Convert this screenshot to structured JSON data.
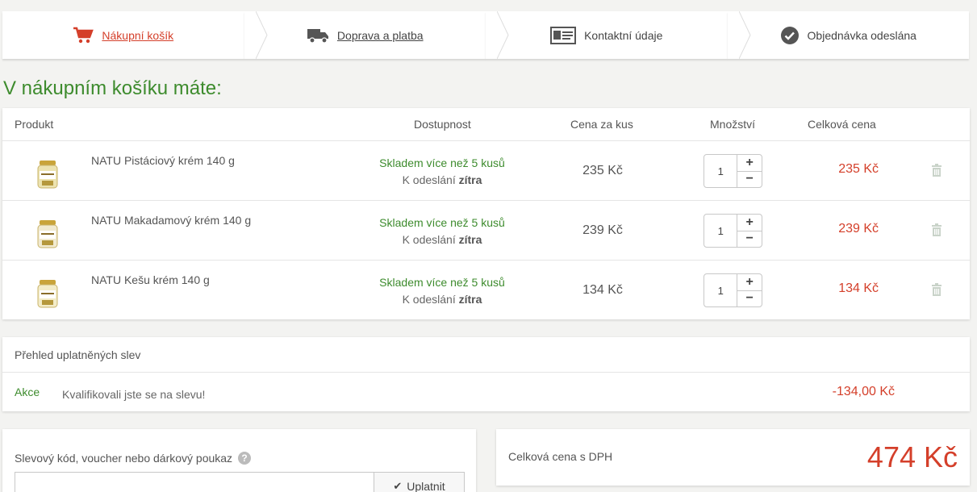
{
  "steps": [
    {
      "label": "Nákupní košík",
      "icon": "cart-icon"
    },
    {
      "label": "Doprava a platba",
      "icon": "truck-icon"
    },
    {
      "label": "Kontaktní údaje",
      "icon": "contact-card-icon"
    },
    {
      "label": "Objednávka odeslána",
      "icon": "check-circle-icon"
    }
  ],
  "page_title": "V nákupním košíku máte:",
  "cart": {
    "columns": {
      "product": "Produkt",
      "availability": "Dostupnost",
      "unit_price": "Cena za kus",
      "quantity": "Množství",
      "total": "Celková cena"
    },
    "items": [
      {
        "name": "NATU Pistáciový krém 140 g",
        "stock": "Skladem více než 5 kusů",
        "ship_prefix": "K odeslání",
        "ship_day": "zítra",
        "unit_price": "235 Kč",
        "qty": "1",
        "total": "235 Kč"
      },
      {
        "name": "NATU Makadamový krém 140 g",
        "stock": "Skladem více než 5 kusů",
        "ship_prefix": "K odeslání",
        "ship_day": "zítra",
        "unit_price": "239 Kč",
        "qty": "1",
        "total": "239 Kč"
      },
      {
        "name": "NATU Kešu krém 140 g",
        "stock": "Skladem více než 5 kusů",
        "ship_prefix": "K odeslání",
        "ship_day": "zítra",
        "unit_price": "134 Kč",
        "qty": "1",
        "total": "134 Kč"
      }
    ],
    "plus": "+",
    "minus": "−"
  },
  "discounts": {
    "title": "Přehled uplatněných slev",
    "label": "Akce",
    "text": "Kvalifikovali jste se na slevu!",
    "amount": "-134,00 Kč"
  },
  "voucher": {
    "label": "Slevový kód, voucher nebo dárkový poukaz",
    "help": "?",
    "input_value": "",
    "button": "Uplatnit"
  },
  "summary": {
    "label": "Celková cena s DPH",
    "value": "474 Kč"
  },
  "colors": {
    "accent_red": "#d43f2a",
    "accent_green": "#3d8b2d"
  }
}
